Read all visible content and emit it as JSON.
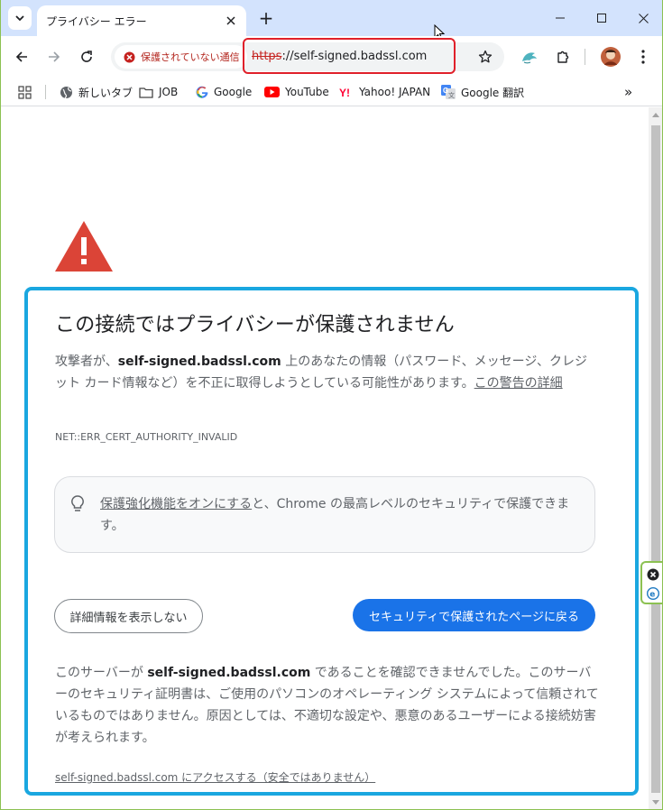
{
  "browser": {
    "tab": {
      "title": "プライバシー エラー"
    },
    "new_tab_symbol": "+",
    "address_bar": {
      "security_chip_label": "保護されていない通信",
      "url_scheme": "https",
      "url_rest": "://self-signed.badssl.com"
    },
    "bookmarks": [
      {
        "label": "新しいタブ",
        "icon": "globe-icon"
      },
      {
        "label": "JOB",
        "icon": "folder-icon"
      },
      {
        "label": "Google",
        "icon": "google-icon"
      },
      {
        "label": "YouTube",
        "icon": "youtube-icon"
      },
      {
        "label": "Yahoo! JAPAN",
        "icon": "yahoo-icon"
      },
      {
        "label": "Google 翻訳",
        "icon": "google-translate-icon"
      }
    ],
    "bookmarks_overflow": "»"
  },
  "page": {
    "heading": "この接続ではプライバシーが保護されません",
    "para1_prefix": "攻撃者が、",
    "para1_domain": "self-signed.badssl.com",
    "para1_suffix": " 上のあなたの情報（パスワード、メッセージ、クレジット カード情報など）を不正に取得しようとしている可能性があります。",
    "para1_link": "この警告の詳細",
    "error_code": "NET::ERR_CERT_AUTHORITY_INVALID",
    "enhanced_link": "保護強化機能をオンにする",
    "enhanced_text": "と、Chrome の最高レベルのセキュリティで保護できます。",
    "details_button": "詳細情報を表示しない",
    "back_button": "セキュリティで保護されたページに戻る",
    "para2_prefix": "このサーバーが ",
    "para2_domain": "self-signed.badssl.com",
    "para2_suffix": " であることを確認できませんでした。このサーバーのセキュリティ証明書は、ご使用のパソコンのオペレーティング システムによって信頼されているものではありません。原因としては、不適切な設定や、悪意のあるユーザーによる接続妨害が考えられます。",
    "proceed_link": "self-signed.badssl.com にアクセスする（安全ではありません）"
  },
  "colors": {
    "accent_blue": "#1a73e8",
    "warning_red": "#db4437",
    "highlight_cyan": "#1aa7e0",
    "url_highlight_red": "#e0202a"
  }
}
